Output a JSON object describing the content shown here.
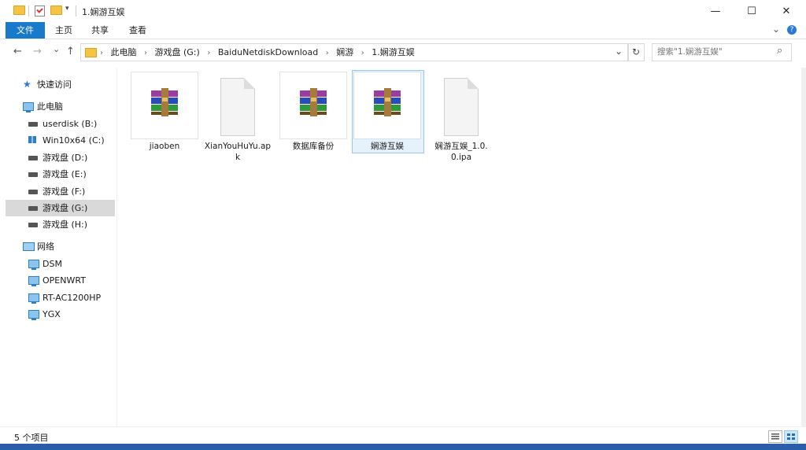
{
  "window": {
    "title": "1.娴游互娱",
    "minimize_glyph": "—",
    "maximize_glyph": "☐",
    "close_glyph": "✕"
  },
  "ribbon": {
    "tabs": [
      {
        "label": "文件",
        "active": true
      },
      {
        "label": "主页"
      },
      {
        "label": "共享"
      },
      {
        "label": "查看"
      }
    ],
    "expand_glyph": "⌄",
    "help_glyph": "?"
  },
  "address_bar": {
    "back_glyph": "←",
    "forward_glyph": "→",
    "recent_glyph": "⌄",
    "up_glyph": "↑",
    "breadcrumbs": [
      "此电脑",
      "游戏盘 (G:)",
      "BaiduNetdiskDownload",
      "娴游",
      "1.娴游互娱"
    ],
    "separator": "›",
    "dropdown_glyph": "⌄",
    "refresh_glyph": "↻"
  },
  "search": {
    "placeholder": "搜索\"1.娴游互娱\"",
    "icon_glyph": "⌕"
  },
  "nav_pane": {
    "quick_access": "快速访问",
    "this_pc": "此电脑",
    "drives": [
      {
        "label": "userdisk (B:)",
        "icon": "drive-icon"
      },
      {
        "label": "Win10x64 (C:)",
        "icon": "windows-drive-icon"
      },
      {
        "label": "游戏盘 (D:)",
        "icon": "drive-icon"
      },
      {
        "label": "游戏盘 (E:)",
        "icon": "drive-icon"
      },
      {
        "label": "游戏盘 (F:)",
        "icon": "drive-icon"
      },
      {
        "label": "游戏盘 (G:)",
        "icon": "drive-icon",
        "selected": true
      },
      {
        "label": "游戏盘 (H:)",
        "icon": "drive-icon"
      }
    ],
    "network": "网络",
    "network_items": [
      "DSM",
      "OPENWRT",
      "RT-AC1200HP",
      "YGX"
    ]
  },
  "files": [
    {
      "name": "jiaoben",
      "icon": "winrar-archive-icon"
    },
    {
      "name": "XianYouHuYu.apk",
      "icon": "blank-file-icon"
    },
    {
      "name": "数据库备份",
      "icon": "winrar-archive-icon"
    },
    {
      "name": "娴游互娱",
      "icon": "winrar-archive-icon",
      "selected": true
    },
    {
      "name": "娴游互娱_1.0.0.ipa",
      "icon": "blank-file-icon"
    }
  ],
  "status_bar": {
    "item_count": "5 个项目"
  },
  "colors": {
    "accent": "#1979ca",
    "selection_bg": "#e5f1fb",
    "selection_border": "#99c9ef",
    "nav_selected": "#d9d9d9"
  }
}
